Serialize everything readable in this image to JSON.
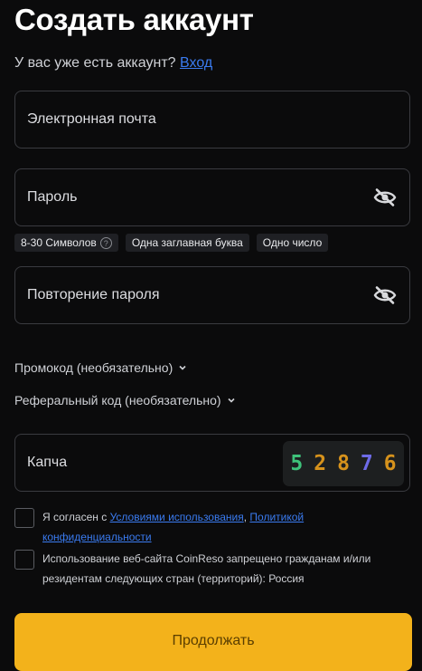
{
  "header": {
    "title": "Создать аккаунт",
    "have_account_text": "У вас уже есть аккаунт?",
    "login_link": "Вход"
  },
  "form": {
    "email_label": "Электронная почта",
    "password_label": "Пароль",
    "password_hints": [
      "8-30 Символов",
      "Одна заглавная буква",
      "Одно число"
    ],
    "repeat_password_label": "Повторение пароля",
    "promo_toggle": "Промокод (необязательно)",
    "referral_toggle": "Реферальный код (необязательно)",
    "captcha_label": "Капча",
    "captcha_digits": [
      "5",
      "2",
      "8",
      "7",
      "6"
    ]
  },
  "agreements": {
    "terms_prefix": "Я согласен с",
    "terms_link": "Условиями использования",
    "separator": ",",
    "privacy_link_1": "Политикой",
    "privacy_link_2": "конфиденциальности",
    "restriction_text_1": "Использование веб-сайта CoinReso запрещено гражданам и/или",
    "restriction_text_2": "резидентам следующих стран (территорий): Россия"
  },
  "submit_label": "Продолжать",
  "colors": {
    "background": "#0b0b0c",
    "accent": "#f3b21b",
    "link": "#3a7bf0",
    "captcha_colors": [
      "#3ec27a",
      "#d6921c",
      "#d6921c",
      "#6e6be8",
      "#d6921c"
    ]
  }
}
